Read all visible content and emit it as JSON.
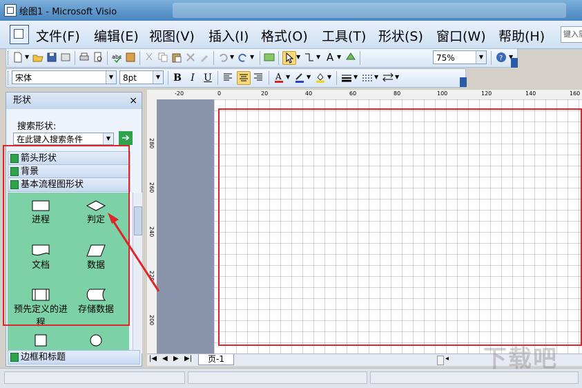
{
  "window": {
    "title": "绘图1 - Microsoft Visio"
  },
  "menu": [
    {
      "label": "文件(F)"
    },
    {
      "label": "编辑(E)"
    },
    {
      "label": "视图(V)"
    },
    {
      "label": "插入(I)"
    },
    {
      "label": "格式(O)"
    },
    {
      "label": "工具(T)"
    },
    {
      "label": "形状(S)"
    },
    {
      "label": "窗口(W)"
    },
    {
      "label": "帮助(H)"
    }
  ],
  "help_search": {
    "placeholder": "键入需要帮助的问题"
  },
  "toolbar": {
    "zoom": "75%"
  },
  "format_toolbar": {
    "font": "宋体",
    "size": "8pt",
    "bold": "B",
    "italic": "I",
    "underline": "U"
  },
  "shapes_pane": {
    "title": "形状",
    "close": "×",
    "search_label": "搜索形状:",
    "search_placeholder": "在此键入搜索条件",
    "stencils": [
      "箭头形状",
      "背景",
      "基本流程图形状"
    ],
    "shapes": [
      "进程",
      "判定",
      "文档",
      "数据",
      "预先定义的进程",
      "存储数据"
    ],
    "bottom_stencil": "边框和标题"
  },
  "ruler": {
    "top": [
      "-20",
      "0",
      "20",
      "40",
      "60",
      "80",
      "100",
      "120",
      "140",
      "160"
    ],
    "left": [
      "280",
      "260",
      "240",
      "220",
      "200"
    ]
  },
  "page_tab": "页-1",
  "watermark": "下载吧",
  "colors": {
    "highlight": "#e0252a",
    "shape_grid": "#7cd1a6",
    "page_border": "#e0252a"
  }
}
